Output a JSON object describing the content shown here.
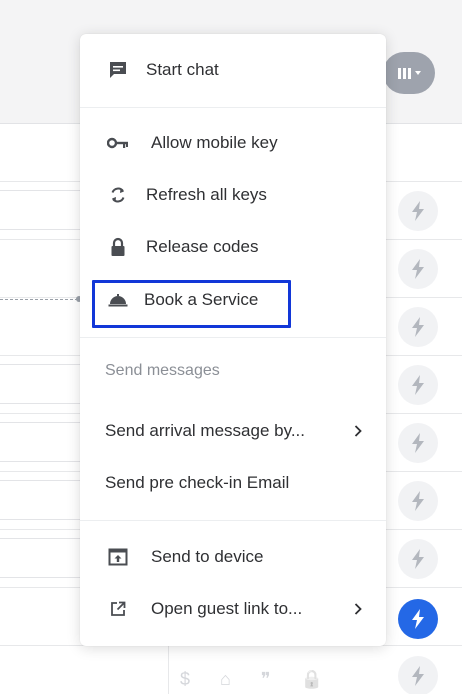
{
  "colors": {
    "accent": "#2468e6",
    "highlight_border": "#1237d8",
    "menu_text": "#2f3033",
    "section_text": "#8b8f96"
  },
  "menu": {
    "start_chat": {
      "label": "Start chat",
      "icon": "chat-icon"
    },
    "allow_mobile_key": {
      "label": "Allow mobile key",
      "icon": "key-icon"
    },
    "refresh_all_keys": {
      "label": "Refresh all keys",
      "icon": "refresh-icon"
    },
    "release_codes": {
      "label": "Release codes",
      "icon": "lock-icon"
    },
    "book_service": {
      "label": "Book a Service",
      "icon": "bell-icon"
    },
    "send_messages_header": "Send messages",
    "send_arrival": {
      "label": "Send arrival message by...",
      "icon": "chevron-right-icon"
    },
    "send_precheckin": {
      "label": "Send pre check-in Email"
    },
    "send_to_device": {
      "label": "Send to device",
      "icon": "device-upload-icon"
    },
    "open_guest_link": {
      "label": "Open guest link to...",
      "icon": "external-link-icon"
    }
  },
  "background": {
    "columns_button_icon": "columns-icon",
    "row_action_icon": "bolt-icon",
    "footer_icons": [
      "dollar-icon",
      "home-icon",
      "quote-icon",
      "lock-icon"
    ],
    "footer_glyphs": [
      "$",
      "⌂",
      "❞",
      "🔒"
    ]
  }
}
